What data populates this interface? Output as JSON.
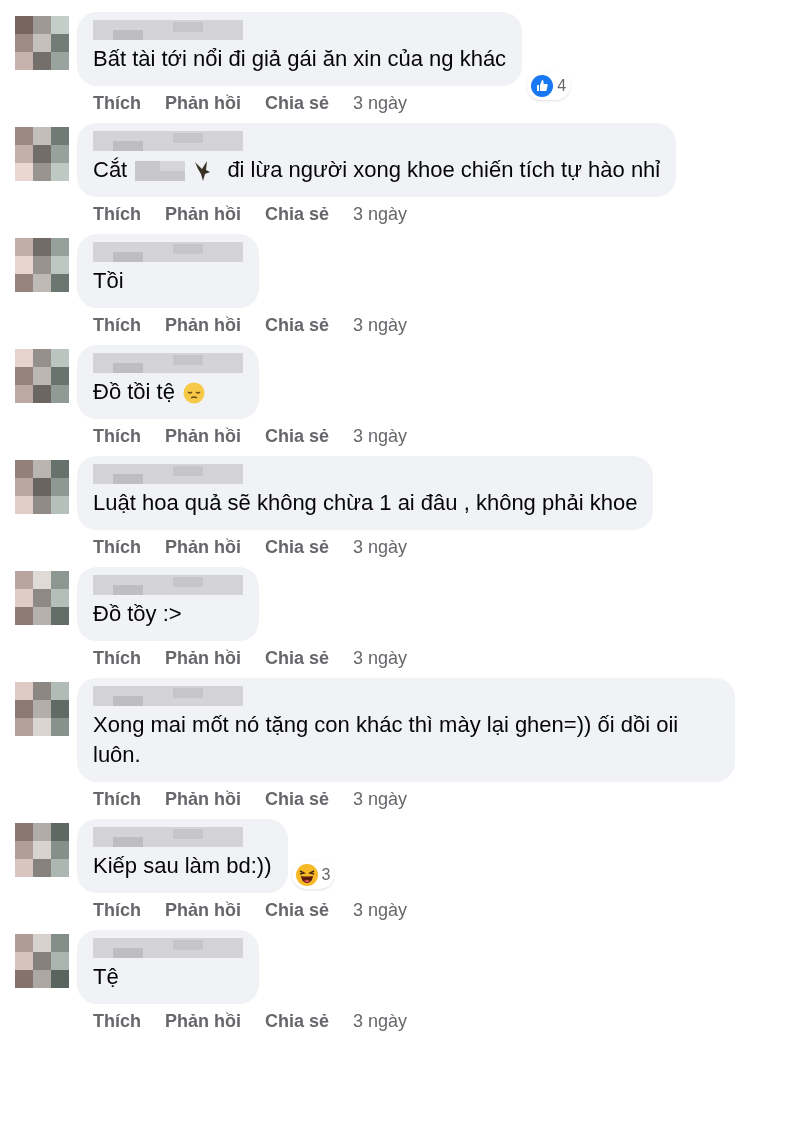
{
  "comments": [
    {
      "segments": [
        {
          "kind": "text",
          "text": "Bất tài tới nổi đi giả gái ăn xin của ng khác"
        }
      ],
      "reaction": {
        "kind": "like",
        "count": "4"
      },
      "actions": [
        "Thích",
        "Phản hồi",
        "Chia sẻ"
      ],
      "time": "3 ngày"
    },
    {
      "segments": [
        {
          "kind": "text",
          "text": "Cắt"
        },
        {
          "kind": "redacted"
        },
        {
          "kind": "bird"
        },
        {
          "kind": "text",
          "text": "đi lừa người xong khoe chiến tích tự hào nhỉ"
        }
      ],
      "actions": [
        "Thích",
        "Phản hồi",
        "Chia sẻ"
      ],
      "time": "3 ngày"
    },
    {
      "segments": [
        {
          "kind": "text",
          "text": "Tồi"
        }
      ],
      "actions": [
        "Thích",
        "Phản hồi",
        "Chia sẻ"
      ],
      "time": "3 ngày"
    },
    {
      "segments": [
        {
          "kind": "text",
          "text": "Đồ tồi tệ"
        },
        {
          "kind": "sad-emoji"
        }
      ],
      "actions": [
        "Thích",
        "Phản hồi",
        "Chia sẻ"
      ],
      "time": "3 ngày"
    },
    {
      "segments": [
        {
          "kind": "text",
          "text": "Luật hoa quả sẽ không chừa 1 ai đâu , không phải khoe"
        }
      ],
      "actions": [
        "Thích",
        "Phản hồi",
        "Chia sẻ"
      ],
      "time": "3 ngày"
    },
    {
      "segments": [
        {
          "kind": "text",
          "text": "Đồ tồy :>"
        }
      ],
      "actions": [
        "Thích",
        "Phản hồi",
        "Chia sẻ"
      ],
      "time": "3 ngày"
    },
    {
      "segments": [
        {
          "kind": "text",
          "text": "Xong mai mốt nó tặng con khác thì mày lại ghen=)) ối dồi oii luôn."
        }
      ],
      "actions": [
        "Thích",
        "Phản hồi",
        "Chia sẻ"
      ],
      "time": "3 ngày"
    },
    {
      "segments": [
        {
          "kind": "text",
          "text": "Kiếp sau làm bd:))"
        }
      ],
      "reaction": {
        "kind": "haha",
        "count": "3"
      },
      "actions": [
        "Thích",
        "Phản hồi",
        "Chia sẻ"
      ],
      "time": "3 ngày"
    },
    {
      "segments": [
        {
          "kind": "text",
          "text": "Tệ"
        }
      ],
      "actions": [
        "Thích",
        "Phản hồi",
        "Chia sẻ"
      ],
      "time": "3 ngày"
    }
  ]
}
